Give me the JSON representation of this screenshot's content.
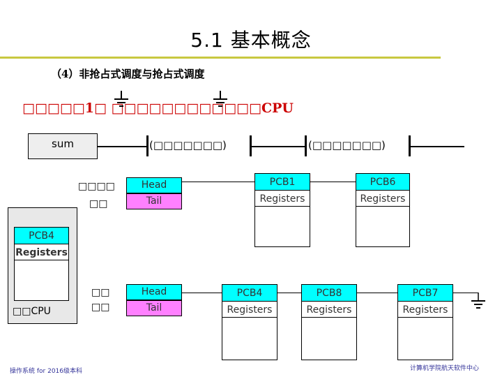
{
  "slide": {
    "title": "5.1  基本概念",
    "subtitle": "（4）非抢占式调度与抢占式调度",
    "heading": "□□□□□1□ □□□□□□□□□□□□CPU",
    "footer_left": "操作系统 for 2016级本科",
    "footer_right": "计算机学院航天软件中心"
  },
  "timeline": {
    "sum_label": "sum",
    "segment1_label": "(□□□□□□□)",
    "segment2_label": "(□□□□□□□)"
  },
  "queue1": {
    "side_label_line1": "□□□□",
    "side_label_line2": "□□",
    "head": "Head",
    "tail": "Tail",
    "pcbs": [
      {
        "name": "PCB1",
        "reg": "Registers"
      },
      {
        "name": "PCB6",
        "reg": "Registers"
      }
    ]
  },
  "queue2": {
    "side_label_line1": "□□",
    "side_label_line2": "□□",
    "head": "Head",
    "tail": "Tail",
    "pcbs": [
      {
        "name": "PCB4",
        "reg": "Registers"
      },
      {
        "name": "PCB8",
        "reg": "Registers"
      },
      {
        "name": "PCB7",
        "reg": "Registers"
      }
    ]
  },
  "cpu": {
    "pcb_name": "PCB4",
    "reg": "Registers",
    "label": "□□CPU"
  },
  "colors": {
    "title_rule": "#c8c840",
    "heading": "#cc0000",
    "pcb_header": "#00ffff",
    "tail_fill": "#ff80ff",
    "cpu_panel": "#e8e8e8"
  }
}
